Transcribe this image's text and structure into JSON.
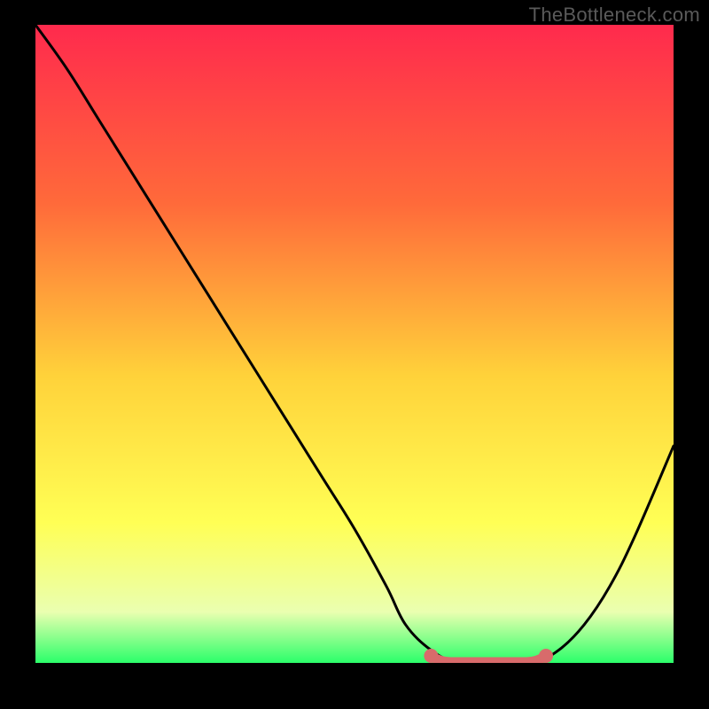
{
  "watermark": "TheBottleneck.com",
  "colors": {
    "frame_bg": "#000000",
    "gradient_top": "#ff2a4d",
    "gradient_mid1": "#ff6a3a",
    "gradient_mid2": "#ffd23a",
    "gradient_mid3": "#ffff55",
    "gradient_mid4": "#eaffb0",
    "gradient_bottom": "#2bff6a",
    "curve": "#000000",
    "plateau_marker": "#d86b6b"
  },
  "chart_data": {
    "type": "line",
    "title": "",
    "xlabel": "",
    "ylabel": "",
    "xlim": [
      0,
      100
    ],
    "ylim": [
      0,
      100
    ],
    "x": [
      0,
      5,
      10,
      15,
      20,
      25,
      30,
      35,
      40,
      45,
      50,
      55,
      58,
      62,
      66,
      70,
      74,
      78,
      82,
      86,
      90,
      94,
      100
    ],
    "series": [
      {
        "name": "bottleneck-curve",
        "values": [
          100,
          93,
          85,
          77,
          69,
          61,
          53,
          45,
          37,
          29,
          21,
          12,
          6,
          2,
          0,
          0,
          0,
          0,
          2,
          6,
          12,
          20,
          34
        ]
      }
    ],
    "plateau": {
      "x_start": 62,
      "x_end": 80,
      "y": 0
    }
  }
}
